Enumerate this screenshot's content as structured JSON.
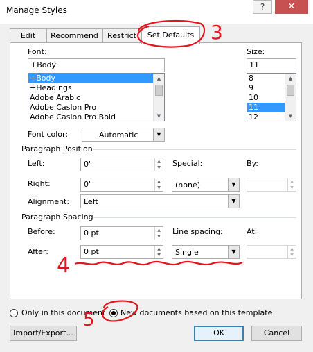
{
  "window": {
    "title": "Manage Styles",
    "help_label": "?",
    "close_label": "✕"
  },
  "tabs": [
    "Edit",
    "Recommend",
    "Restrict",
    "Set Defaults"
  ],
  "font": {
    "label": "Font:",
    "value": "+Body",
    "options": [
      "+Body",
      "+Headings",
      "Adobe Arabic",
      "Adobe Caslon Pro",
      "Adobe Caslon Pro Bold"
    ],
    "selected_index": 0
  },
  "size": {
    "label": "Size:",
    "value": "11",
    "options": [
      "8",
      "9",
      "10",
      "11",
      "12"
    ],
    "selected_index": 3
  },
  "font_color": {
    "label": "Font color:",
    "value": "Automatic"
  },
  "paragraph_position": {
    "heading": "Paragraph Position",
    "left_label": "Left:",
    "left_value": "0\"",
    "right_label": "Right:",
    "right_value": "0\"",
    "special_label": "Special:",
    "special_value": "(none)",
    "by_label": "By:",
    "by_value": "",
    "alignment_label": "Alignment:",
    "alignment_value": "Left"
  },
  "paragraph_spacing": {
    "heading": "Paragraph Spacing",
    "before_label": "Before:",
    "before_value": "0 pt",
    "after_label": "After:",
    "after_value": "0 pt",
    "line_spacing_label": "Line spacing:",
    "line_spacing_value": "Single",
    "at_label": "At:",
    "at_value": ""
  },
  "scope": {
    "only_doc_label": "Only in this document",
    "new_docs_label": "New documents based on this template",
    "selected": "new_docs"
  },
  "buttons": {
    "import_export": "Import/Export...",
    "ok": "OK",
    "cancel": "Cancel"
  },
  "annotations": {
    "tab_note": "3",
    "after_note": "4",
    "radio_note": "5",
    "color": "#e3141c"
  }
}
